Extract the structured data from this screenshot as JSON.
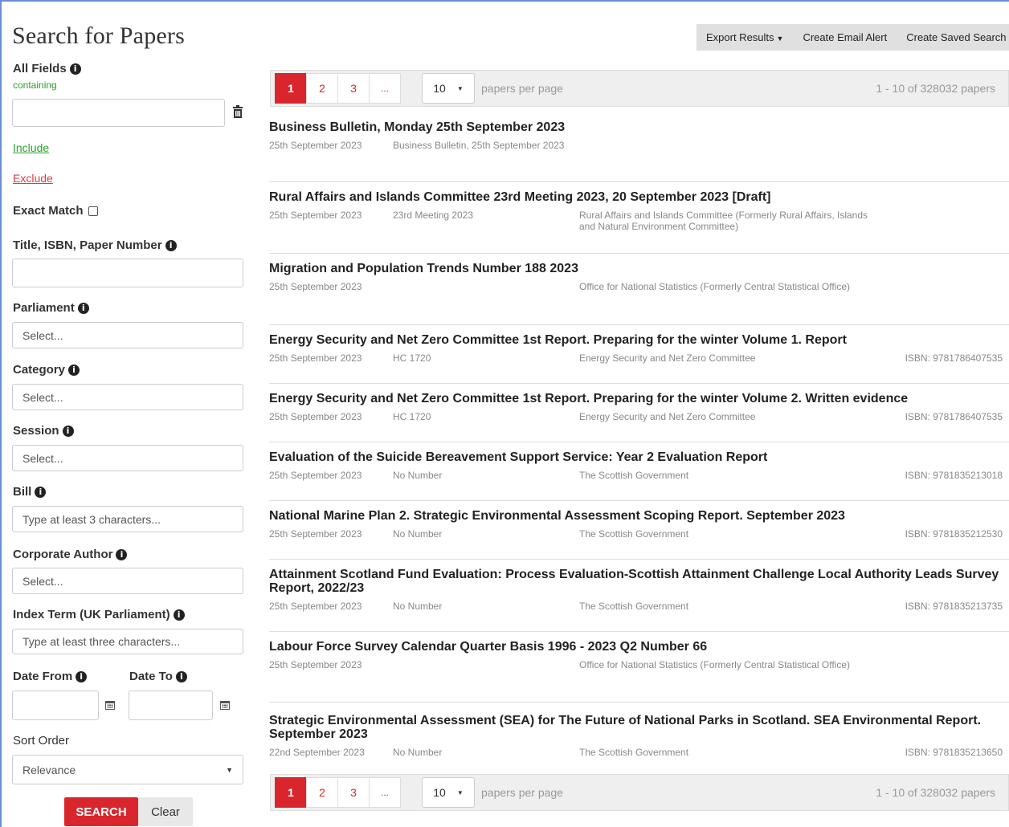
{
  "sidebar": {
    "title": "Search for Papers",
    "all_fields_label": "All Fields",
    "containing_label": "containing",
    "include_link": "Include",
    "exclude_link": "Exclude",
    "exact_match_label": "Exact Match",
    "title_isbn_label": "Title, ISBN, Paper Number",
    "parliament_label": "Parliament",
    "parliament_value": "Select...",
    "category_label": "Category",
    "category_value": "Select...",
    "session_label": "Session",
    "session_value": "Select...",
    "bill_label": "Bill",
    "bill_placeholder": "Type at least 3 characters...",
    "corporate_author_label": "Corporate Author",
    "corporate_author_value": "Select...",
    "index_term_label": "Index Term (UK Parliament)",
    "index_term_placeholder": "Type at least three characters...",
    "date_from_label": "Date From",
    "date_to_label": "Date To",
    "sort_order_label": "Sort Order",
    "sort_order_value": "Relevance",
    "search_button": "SEARCH",
    "clear_button": "Clear"
  },
  "toolbar": {
    "export_label": "Export Results",
    "email_alert_label": "Create Email Alert",
    "saved_search_label": "Create Saved Search"
  },
  "pagination": {
    "pages": [
      "1",
      "2",
      "3",
      "..."
    ],
    "per_page_value": "10",
    "per_page_label": "papers per page",
    "range_text": "1 - 10 of 328032 papers"
  },
  "results": [
    {
      "title": "Business Bulletin, Monday 25th September 2023",
      "date": "25th September 2023",
      "number": "Business Bulletin, 25th September 2023",
      "author": "",
      "isbn": ""
    },
    {
      "title": "Rural Affairs and Islands Committee 23rd Meeting 2023, 20 September 2023 [Draft]",
      "date": "25th September 2023",
      "number": "23rd Meeting 2023",
      "author": "Rural Affairs and Islands Committee (Formerly Rural Affairs, Islands and Natural Environment Committee)",
      "isbn": ""
    },
    {
      "title": "Migration and Population Trends Number 188 2023",
      "date": "25th September 2023",
      "number": "",
      "author": "Office for National Statistics (Formerly Central Statistical Office)",
      "isbn": ""
    },
    {
      "title": "Energy Security and Net Zero Committee 1st Report. Preparing for the winter Volume 1. Report",
      "date": "25th September 2023",
      "number": "HC 1720",
      "author": "Energy Security and Net Zero Committee",
      "isbn": "ISBN: 9781786407535"
    },
    {
      "title": "Energy Security and Net Zero Committee 1st Report. Preparing for the winter Volume 2. Written evidence",
      "date": "25th September 2023",
      "number": "HC 1720",
      "author": "Energy Security and Net Zero Committee",
      "isbn": "ISBN: 9781786407535"
    },
    {
      "title": "Evaluation of the Suicide Bereavement Support Service: Year 2 Evaluation Report",
      "date": "25th September 2023",
      "number": "No Number",
      "author": "The Scottish Government",
      "isbn": "ISBN: 9781835213018"
    },
    {
      "title": "National Marine Plan 2. Strategic Environmental Assessment Scoping Report. September 2023",
      "date": "25th September 2023",
      "number": "No Number",
      "author": "The Scottish Government",
      "isbn": "ISBN: 9781835212530"
    },
    {
      "title": "Attainment Scotland Fund Evaluation: Process Evaluation-Scottish Attainment Challenge Local Authority Leads Survey Report, 2022/23",
      "date": "25th September 2023",
      "number": "No Number",
      "author": "The Scottish Government",
      "isbn": "ISBN: 9781835213735"
    },
    {
      "title": "Labour Force Survey Calendar Quarter Basis 1996 - 2023 Q2 Number 66",
      "date": "25th September 2023",
      "number": "",
      "author": "Office for National Statistics (Formerly Central Statistical Office)",
      "isbn": ""
    },
    {
      "title": "Strategic Environmental Assessment (SEA) for The Future of National Parks in Scotland. SEA Environmental Report. September 2023",
      "date": "22nd September 2023",
      "number": "No Number",
      "author": "The Scottish Government",
      "isbn": "ISBN: 9781835213650"
    }
  ],
  "colors": {
    "accent": "#d9262c",
    "include": "#2ba32b",
    "exclude": "#e0393e",
    "frame": "#6b8fd6"
  },
  "icons": [
    "info-icon",
    "trash-icon",
    "calendar-icon",
    "caret-down-icon"
  ]
}
